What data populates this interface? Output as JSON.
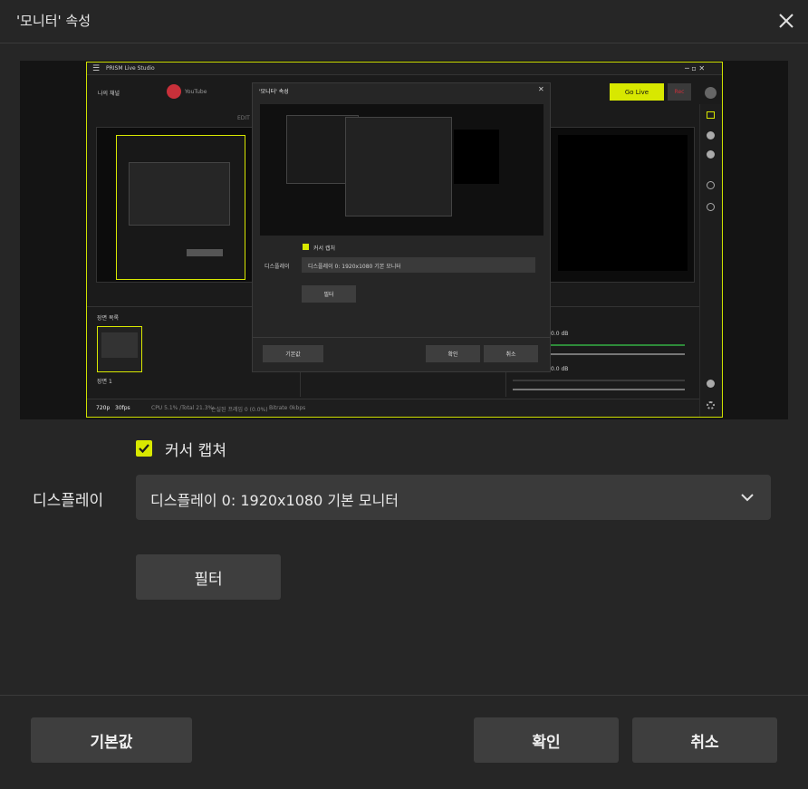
{
  "window": {
    "title": "'모니터' 속성"
  },
  "preview": {
    "app_name": "PRISM Live Studio",
    "channel_label": "나의 채널",
    "platform_label": "YouTube",
    "go_live_label": "Go Live",
    "rec_label": "Rec",
    "edit_label": "EDIT",
    "scene_list_label": "장면 목록",
    "scene_name": "장면 1",
    "audio_db_1": "0.0 dB",
    "audio_db_2": "0.0 dB",
    "status_resolution": "720p",
    "status_fps": "30fps",
    "status_cpu": "CPU 5.1% /Total 21.3%",
    "status_drop": "손실된 프레임 0 (0.0%)",
    "status_bitrate": "Bitrate 0kbps",
    "nested_dialog": {
      "title": "'모니터' 속성",
      "cursor_capture_label": "커서 캡처",
      "display_label": "디스플레이",
      "display_value": "디스플레이 0: 1920x1080 기본 모니터",
      "filter_label": "필터",
      "defaults_label": "기본값",
      "ok_label": "확인",
      "cancel_label": "취소"
    }
  },
  "form": {
    "cursor_capture": {
      "label": "커서 캡쳐",
      "checked": true
    },
    "display": {
      "label": "디스플레이",
      "value": "디스플레이 0: 1920x1080 기본 모니터"
    },
    "filter_button": "필터"
  },
  "footer": {
    "defaults_button": "기본값",
    "ok_button": "확인",
    "cancel_button": "취소"
  },
  "colors": {
    "accent": "#d8e800",
    "rec": "#c8303a",
    "background": "#262626"
  }
}
